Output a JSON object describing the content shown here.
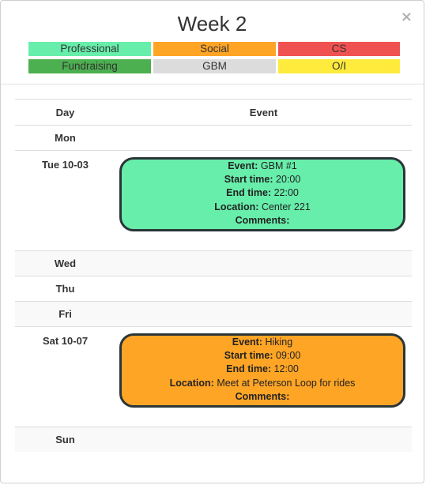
{
  "title": "Week 2",
  "close": "×",
  "legend": [
    {
      "label": "Professional",
      "color": "#67EEAA"
    },
    {
      "label": "Social",
      "color": "#FFA526"
    },
    {
      "label": "CS",
      "color": "#F05252"
    },
    {
      "label": "Fundraising",
      "color": "#4CAF50"
    },
    {
      "label": "GBM",
      "color": "#DCDCDC"
    },
    {
      "label": "O/I",
      "color": "#FFEB3B"
    }
  ],
  "table": {
    "headers": [
      "Day",
      "Event"
    ],
    "days": [
      "Mon",
      "Tue 10-03",
      "Wed",
      "Thu",
      "Fri",
      "Sat 10-07",
      "Sun"
    ]
  },
  "field_labels": {
    "event": "Event:",
    "start": "Start time:",
    "end": "End time:",
    "location": "Location:",
    "comments": "Comments:"
  },
  "events": [
    {
      "name": "GBM #1",
      "start": "20:00",
      "end": "22:00",
      "location": "Center 221",
      "comments": "",
      "color": "#67EEAA"
    },
    {
      "name": "Hiking",
      "start": "09:00",
      "end": "12:00",
      "location": "Meet at Peterson Loop for rides",
      "comments": "",
      "color": "#FFA526"
    }
  ]
}
